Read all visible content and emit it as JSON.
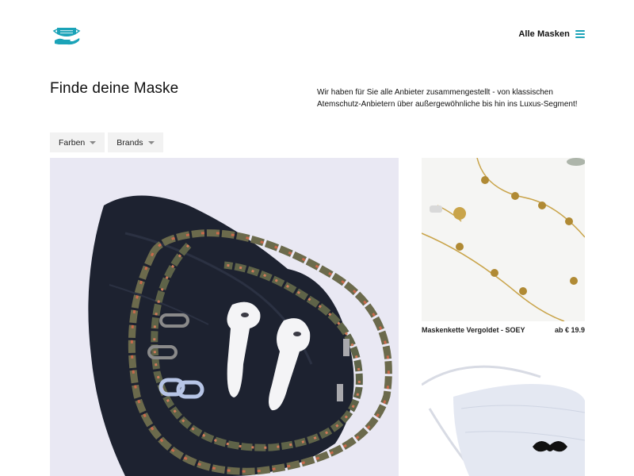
{
  "header": {
    "logo_icon": "mask-hand-icon",
    "menu_label": "Alle Masken",
    "menu_icon": "hamburger-icon",
    "accent_color": "#1ba3b8"
  },
  "main": {
    "title": "Finde deine Maske",
    "intro": "Wir haben für Sie alle Anbieter zusammengestellt - von klassischen Atemschutz-Anbietern über außergewöhnliche bis hin ins Luxus-Segment!"
  },
  "filters": [
    {
      "label": "Farben",
      "icon": "caret-down-icon"
    },
    {
      "label": "Brands",
      "icon": "caret-down-icon"
    }
  ],
  "products": [
    {
      "name": "Maskenkette Vergoldet - SOEY",
      "price": "ab € 19.9"
    },
    {
      "name": "",
      "price": ""
    }
  ]
}
